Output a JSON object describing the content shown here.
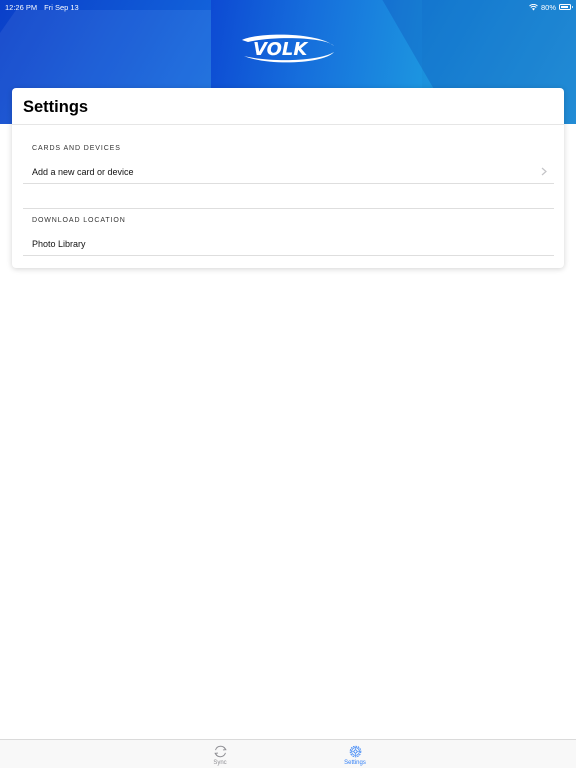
{
  "status_bar": {
    "time": "12:26 PM",
    "date": "Fri Sep 13",
    "battery": "80%",
    "battery_level": 0.8
  },
  "header": {
    "logo_text": "VOLK"
  },
  "settings": {
    "title": "Settings",
    "sections": [
      {
        "header": "CARDS AND DEVICES",
        "rows": [
          {
            "label": "Add a new card or device",
            "has_chevron": true
          }
        ]
      },
      {
        "header": "DOWNLOAD LOCATION",
        "rows": [
          {
            "label": "Photo Library",
            "has_chevron": false
          }
        ]
      }
    ]
  },
  "tab_bar": {
    "tabs": [
      {
        "label": "Sync",
        "icon": "sync-icon",
        "active": false
      },
      {
        "label": "Settings",
        "icon": "gear-icon",
        "active": true
      }
    ]
  },
  "colors": {
    "accent": "#2f7ef6",
    "inactive": "#8e8e93",
    "banner": "#1263db"
  }
}
